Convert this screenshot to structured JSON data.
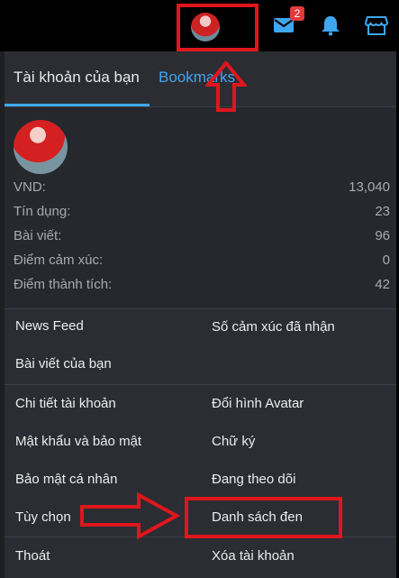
{
  "topbar": {
    "avatar_icon": "user-avatar",
    "inbox_icon": "envelope-icon",
    "inbox_count": "2",
    "alerts_icon": "bell-icon",
    "shop_icon": "store-icon"
  },
  "tabs": {
    "account": "Tài khoản của bạn",
    "bookmarks": "Bookmarks"
  },
  "stats": [
    {
      "label": "VND:",
      "value": "13,040"
    },
    {
      "label": "Tín dụng:",
      "value": "23"
    },
    {
      "label": "Bài viết:",
      "value": "96"
    },
    {
      "label": "Điểm cảm xúc:",
      "value": "0"
    },
    {
      "label": "Điểm thành tích:",
      "value": "42"
    }
  ],
  "menu": {
    "news_feed": "News Feed",
    "reactions_received": "Số cảm xúc đã nhận",
    "your_posts": "Bài viết của bạn",
    "account_details": "Chi tiết tài khoản",
    "change_avatar": "Đổi hình Avatar",
    "password_security": "Mật khẩu và bảo mật",
    "signature": "Chữ ký",
    "privacy": "Bảo mật cá nhân",
    "following": "Đang theo dõi",
    "preferences": "Tùy chọn",
    "ignored": "Danh sách đen",
    "logout": "Thoát",
    "delete_account": "Xóa tài khoản"
  },
  "colors": {
    "accent": "#3fa7f0",
    "panel": "#2b2d33",
    "annotation": "#e0161d"
  }
}
